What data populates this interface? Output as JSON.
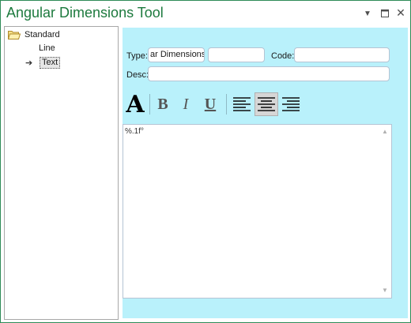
{
  "window": {
    "title": "Angular Dimensions Tool",
    "controls": {
      "dropdown_icon": "chevron-down-icon",
      "maximize_icon": "maximize-icon",
      "close_icon": "close-icon"
    }
  },
  "tree": {
    "root": {
      "label": "Standard",
      "icon": "folder-open-icon"
    },
    "items": [
      {
        "label": "Line"
      },
      {
        "label": "Text",
        "selected": true,
        "icon": "arrow-right-icon"
      }
    ]
  },
  "form": {
    "type_label": "Type:",
    "type_value": "ar Dimensions",
    "type_extra_value": "",
    "code_label": "Code:",
    "code_value": "",
    "desc_label": "Desc:",
    "desc_value": ""
  },
  "toolbar": {
    "font_glyph": "A",
    "bold_glyph": "B",
    "italic_glyph": "I",
    "underline_glyph": "U",
    "active_alignment": "center"
  },
  "text_area": {
    "content": "%.1f°"
  },
  "colors": {
    "title": "#1d7a3e",
    "window_border": "#2e8b57",
    "panel_background": "#b9f1fb"
  }
}
